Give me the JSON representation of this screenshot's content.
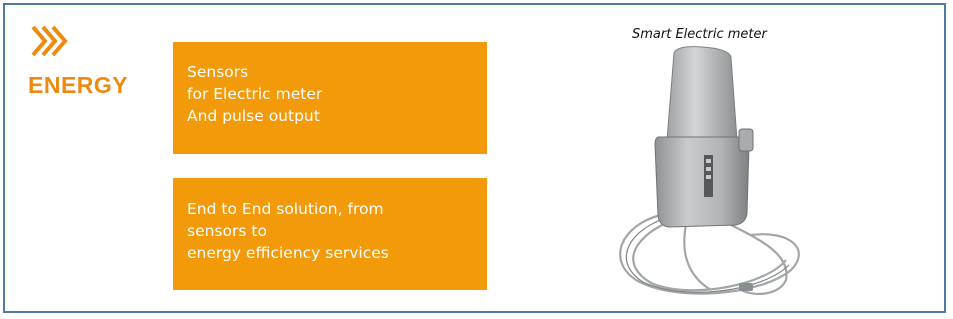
{
  "section": {
    "icon": "triple-chevron-icon",
    "title": "ENERGY",
    "accent_color": "#f39a0a"
  },
  "cards": [
    {
      "lines": [
        "Sensors",
        "for Electric meter",
        "And pulse output"
      ]
    },
    {
      "lines": [
        "End to End solution, from",
        "sensors to",
        "energy efficiency services"
      ]
    }
  ],
  "product": {
    "caption": "Smart Electric meter",
    "image": "smart-electric-meter-sensor"
  },
  "colors": {
    "frame_border": "#4f7aa8",
    "card_background": "#f39a0a",
    "title_color": "#ee8a10"
  }
}
